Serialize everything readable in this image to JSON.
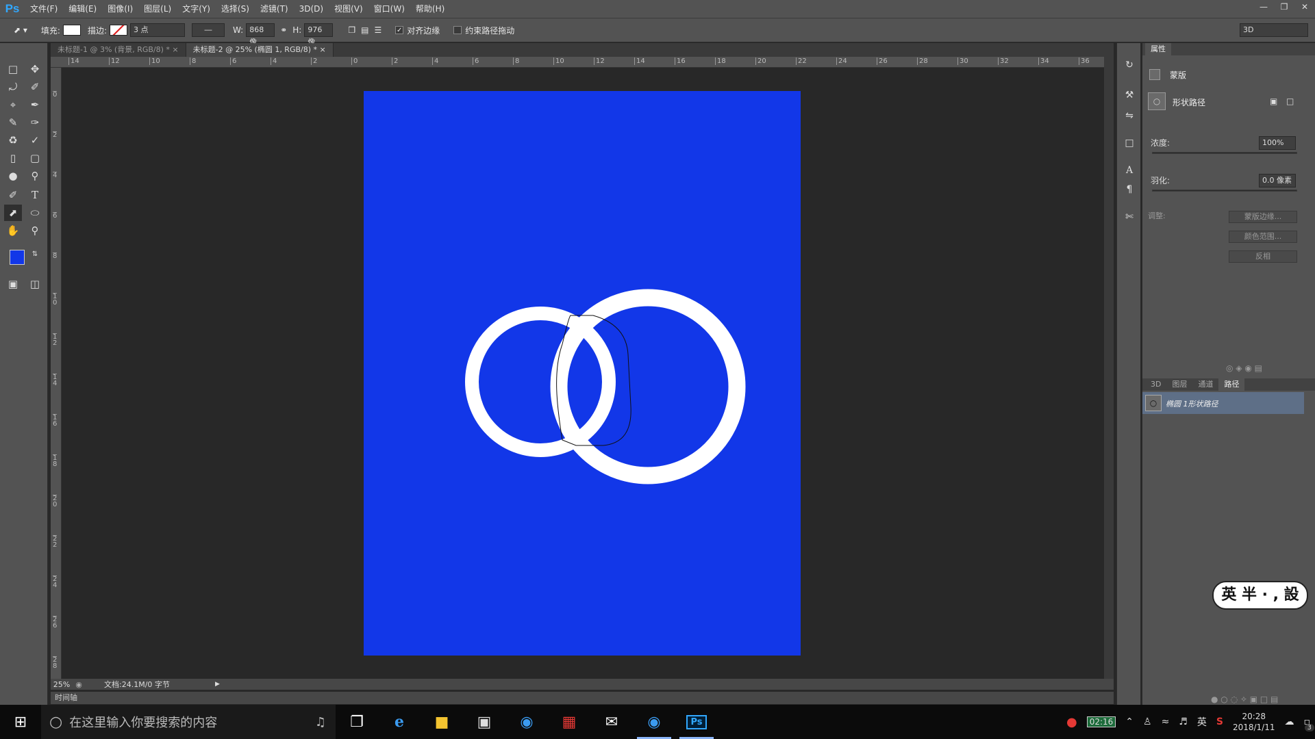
{
  "app": {
    "logo": "Ps",
    "menu": [
      "文件(F)",
      "编辑(E)",
      "图像(I)",
      "图层(L)",
      "文字(Y)",
      "选择(S)",
      "滤镜(T)",
      "3D(D)",
      "视图(V)",
      "窗口(W)",
      "帮助(H)"
    ]
  },
  "options": {
    "fill_label": "填充:",
    "stroke_label": "描边:",
    "stroke_width": "3 点",
    "w_label": "W:",
    "w_value": "868 像",
    "h_label": "H:",
    "h_value": "976 像",
    "align_edges": "对齐边缘",
    "constrain_path": "约束路径拖动",
    "workspace": "3D"
  },
  "tabs": [
    "未标题-1 @ 3% (背景, RGB/8) *",
    "未标题-2 @ 25% (椭圆 1, RGB/8) *"
  ],
  "ruler": {
    "top": [
      "14",
      "12",
      "10",
      "8",
      "6",
      "4",
      "2",
      "0",
      "2",
      "4",
      "6",
      "8",
      "10",
      "12",
      "14",
      "16",
      "18",
      "20",
      "22",
      "24",
      "26",
      "28",
      "30",
      "32",
      "34",
      "36"
    ],
    "left": [
      "0",
      "2",
      "4",
      "6",
      "8",
      "10",
      "12",
      "14",
      "16",
      "18",
      "20",
      "22",
      "24",
      "26",
      "28"
    ]
  },
  "status": {
    "zoom": "25%",
    "doc": "文档:24.1M/0 字节"
  },
  "timeline": "时间轴",
  "properties": {
    "title": "属性",
    "mask": "蒙版",
    "shape_path": "形状路径",
    "density_label": "浓度:",
    "density_value": "100%",
    "feather_label": "羽化:",
    "feather_value": "0.0 像素",
    "adjust_label": "调整:",
    "btn_mask_edge": "蒙版边缘...",
    "btn_color_range": "颜色范围...",
    "btn_invert": "反相"
  },
  "layers": {
    "tabs": [
      "3D",
      "图层",
      "通道",
      "路径"
    ],
    "active_tab": "路径",
    "path_item": "椭圆 1形状路径"
  },
  "sticker": "英 半 · , 設",
  "taskbar": {
    "search_placeholder": "在这里输入你要搜索的内容",
    "battery": "02:16",
    "ime": "英",
    "time": "20:28",
    "date": "2018/1/11",
    "notif": "3"
  },
  "colors": {
    "fg": "#1237e8",
    "bg": "#ffffff",
    "doc": "#1237e8"
  }
}
